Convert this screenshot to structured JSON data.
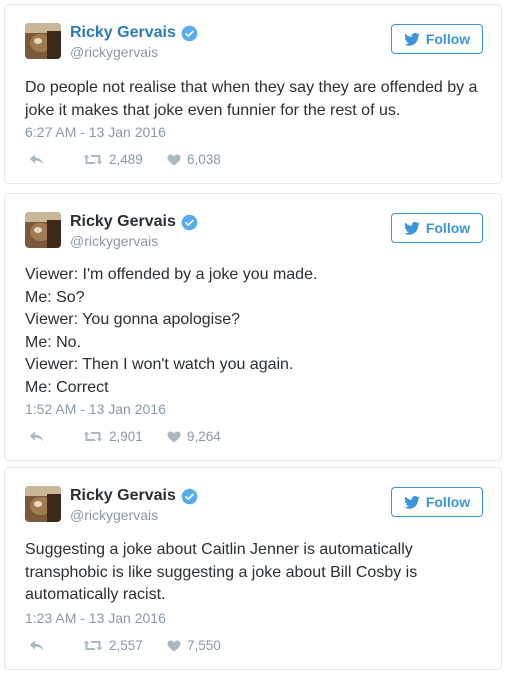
{
  "tweets": [
    {
      "name": "Ricky Gervais",
      "handle": "@rickygervais",
      "follow_label": "Follow",
      "lines": [
        "Do people not realise that when they say they are offended by a",
        "joke it makes that joke even funnier for the rest of us."
      ],
      "timestamp": "6:27 AM - 13 Jan 2016",
      "retweets": "2,489",
      "likes": "6,038"
    },
    {
      "name": "Ricky Gervais",
      "handle": "@rickygervais",
      "follow_label": "Follow",
      "lines": [
        "Viewer: I'm offended by a joke you made.",
        "Me: So?",
        "Viewer: You gonna apologise?",
        "Me: No.",
        "Viewer: Then I won't watch you again.",
        "Me: Correct"
      ],
      "timestamp": "1:52 AM - 13 Jan 2016",
      "retweets": "2,901",
      "likes": "9,264"
    },
    {
      "name": "Ricky Gervais",
      "handle": "@rickygervais",
      "follow_label": "Follow",
      "lines": [
        "Suggesting a joke about Caitlin Jenner is automatically",
        "transphobic is like suggesting a joke about Bill Cosby is",
        "automatically racist."
      ],
      "timestamp": "1:23 AM - 13 Jan 2016",
      "retweets": "2,557",
      "likes": "7,550"
    }
  ],
  "icons": {
    "verified": "verified-badge-icon",
    "follow": "twitter-bird-icon",
    "reply": "reply-icon",
    "retweet": "retweet-icon",
    "like": "heart-icon"
  },
  "colors": {
    "accent": "#3b94d9",
    "name_link": "#2b7bb9",
    "muted": "#8899a6",
    "border": "#e1e8ed"
  }
}
